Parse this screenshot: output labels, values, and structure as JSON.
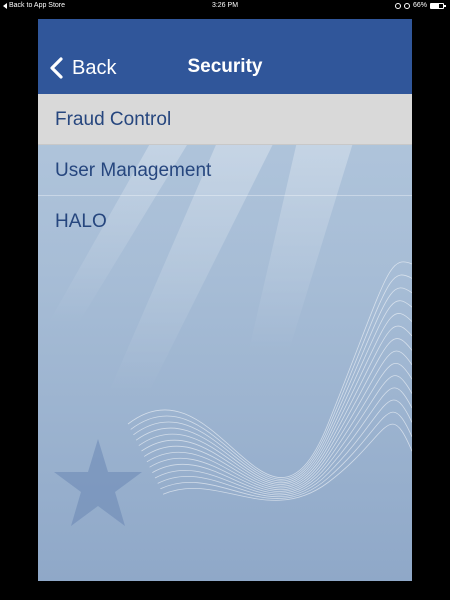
{
  "status_bar": {
    "back_to_app": "Back to App Store",
    "time": "3:26 PM",
    "battery_percent": "66%",
    "battery_level": 0.66
  },
  "nav": {
    "back_label": "Back",
    "title": "Security"
  },
  "menu": {
    "items": [
      {
        "label": "Fraud Control",
        "selected": true
      },
      {
        "label": "User Management",
        "selected": false
      },
      {
        "label": "HALO",
        "selected": false
      }
    ]
  },
  "colors": {
    "nav_bar": "#30569a",
    "menu_text": "#26467e",
    "selected_row": "#d9d9d9"
  }
}
